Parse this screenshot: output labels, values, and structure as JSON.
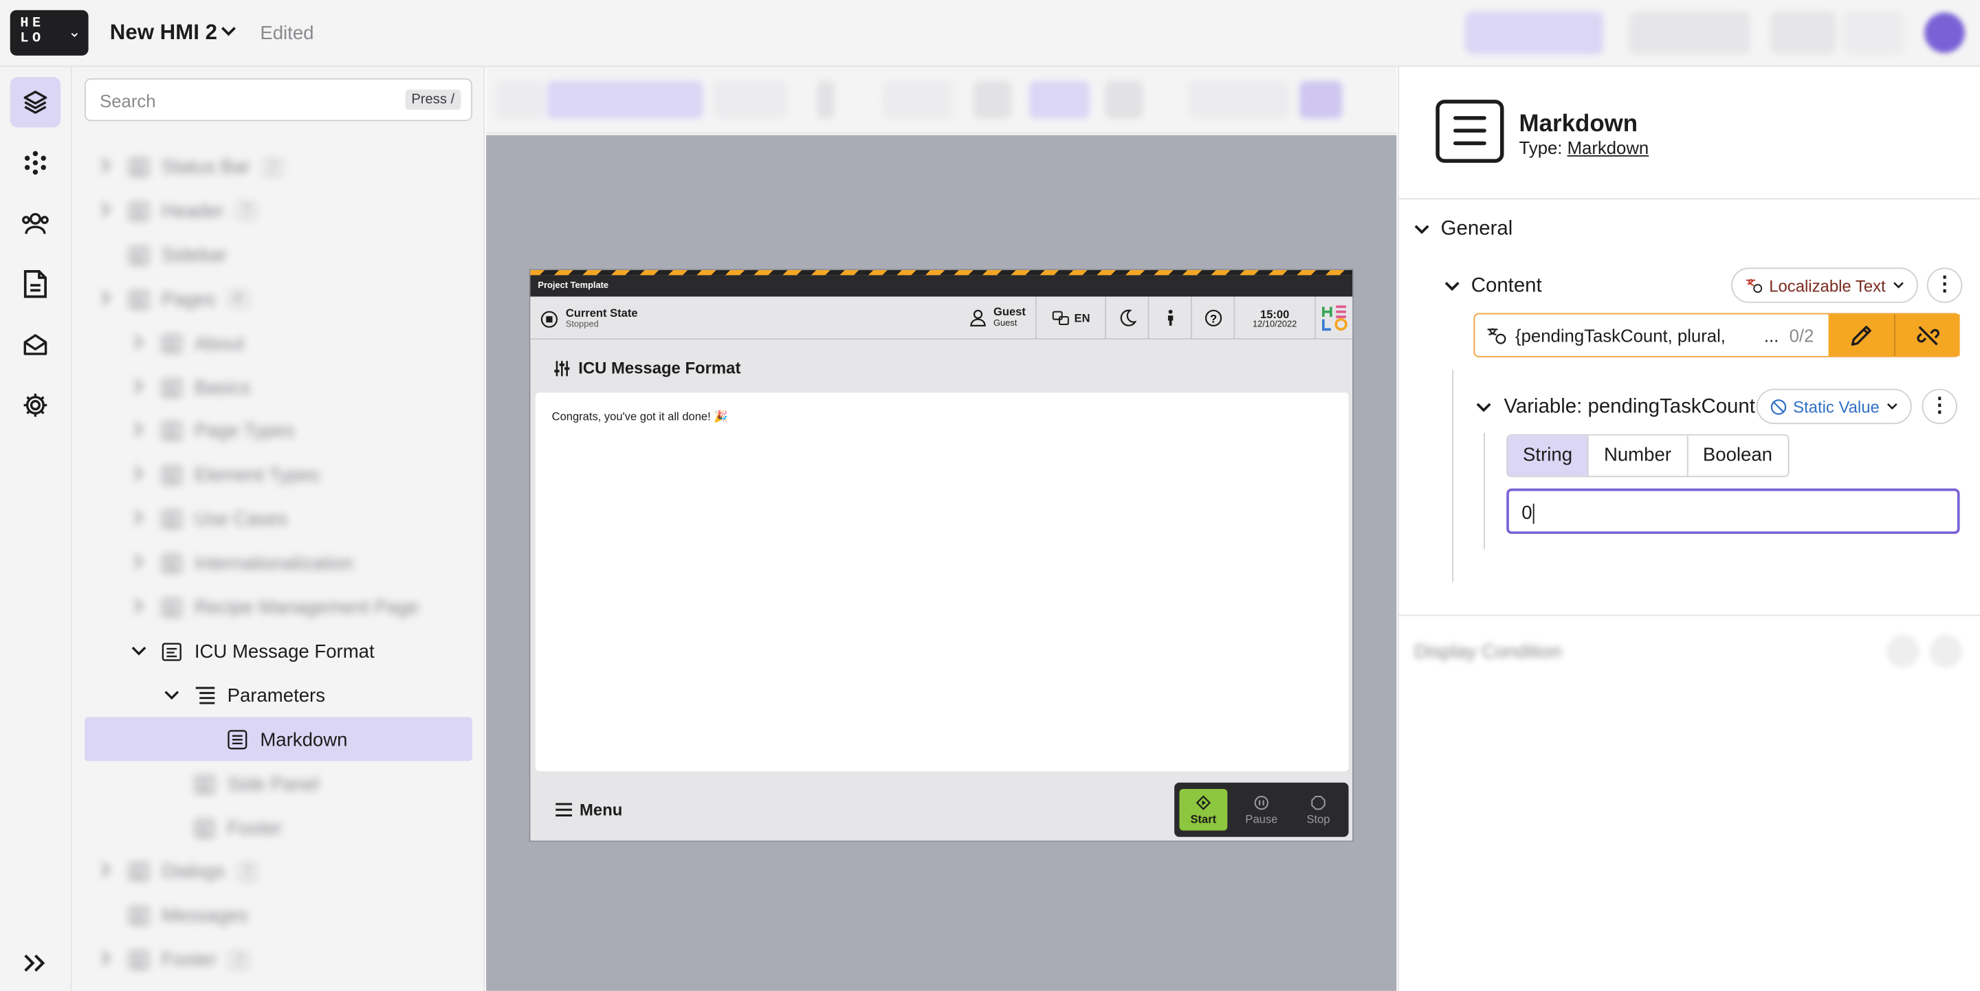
{
  "topbar": {
    "logo_text": "HE LO",
    "project_name": "New HMI 2",
    "status": "Edited"
  },
  "layers": {
    "search_placeholder": "Search",
    "search_shortcut": "Press /",
    "nodes": [
      {
        "label": "Status Bar",
        "badge": "2",
        "blurred": true
      },
      {
        "label": "Header",
        "badge": "2",
        "blurred": true
      },
      {
        "label": "Sidebar",
        "blurred": true
      },
      {
        "label": "Pages",
        "badge": "8",
        "blurred": true
      },
      {
        "label": "About",
        "blurred": true
      },
      {
        "label": "Basics",
        "blurred": true
      },
      {
        "label": "Page Types",
        "blurred": true
      },
      {
        "label": "Element Types",
        "blurred": true
      },
      {
        "label": "Use Cases",
        "blurred": true
      },
      {
        "label": "Internationalization",
        "blurred": true
      },
      {
        "label": "Recipe Management Page",
        "blurred": true
      },
      {
        "label": "ICU Message Format",
        "blurred": false
      },
      {
        "label": "Parameters",
        "blurred": false
      },
      {
        "label": "Markdown",
        "blurred": false,
        "selected": true
      },
      {
        "label": "Side Panel",
        "blurred": true
      },
      {
        "label": "Footer",
        "blurred": true
      },
      {
        "label": "Dialogs",
        "badge": "2",
        "blurred": true
      },
      {
        "label": "Messages",
        "blurred": true
      },
      {
        "label": "Footer",
        "badge": "2",
        "blurred": true
      }
    ]
  },
  "hmi": {
    "template_title": "Project Template",
    "state_label": "Current State",
    "state_value": "Stopped",
    "user_label": "Guest",
    "user_sub": "Guest",
    "language": "EN",
    "time": "15:00",
    "date": "12/10/2022",
    "page_title": "ICU Message Format",
    "body_text": "Congrats, you've got it all done! 🎉",
    "menu_label": "Menu",
    "controls": [
      {
        "label": "Start"
      },
      {
        "label": "Pause"
      },
      {
        "label": "Stop"
      }
    ]
  },
  "properties": {
    "name": "Markdown",
    "type_label": "Type:",
    "type_value": "Markdown",
    "general_label": "General",
    "content_label": "Content",
    "content_type": "Localizable Text",
    "content_value": "{pendingTaskCount, plural,",
    "content_ellipsis": "...",
    "content_count": "0/2",
    "variable_label": "Variable: pendingTaskCount",
    "variable_mode": "Static Value",
    "types": [
      "String",
      "Number",
      "Boolean"
    ],
    "selected_type": "String",
    "value": "0",
    "display_condition_label": "Display Condition"
  },
  "colors": {
    "accent": "#7a62d6",
    "selection": "#dcd6f5",
    "warning": "#f5a623",
    "start_green": "#8dc63f"
  }
}
